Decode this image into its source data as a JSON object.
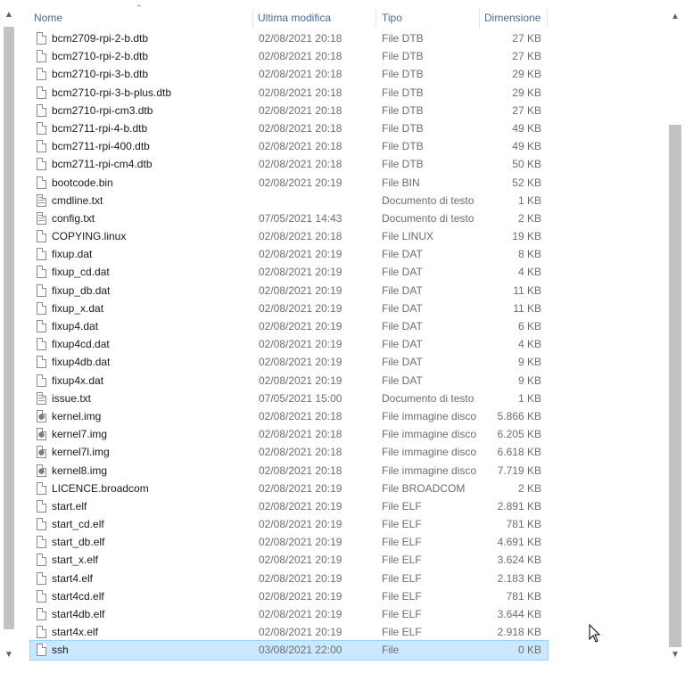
{
  "columns": {
    "name": "Nome",
    "modified": "Ultima modifica",
    "type": "Tipo",
    "size": "Dimensione"
  },
  "files": [
    {
      "name": "bcm2709-rpi-2-b.dtb",
      "modified": "02/08/2021 20:18",
      "type": "File DTB",
      "size": "27 KB",
      "icon": "file-icon"
    },
    {
      "name": "bcm2710-rpi-2-b.dtb",
      "modified": "02/08/2021 20:18",
      "type": "File DTB",
      "size": "27 KB",
      "icon": "file-icon"
    },
    {
      "name": "bcm2710-rpi-3-b.dtb",
      "modified": "02/08/2021 20:18",
      "type": "File DTB",
      "size": "29 KB",
      "icon": "file-icon"
    },
    {
      "name": "bcm2710-rpi-3-b-plus.dtb",
      "modified": "02/08/2021 20:18",
      "type": "File DTB",
      "size": "29 KB",
      "icon": "file-icon"
    },
    {
      "name": "bcm2710-rpi-cm3.dtb",
      "modified": "02/08/2021 20:18",
      "type": "File DTB",
      "size": "27 KB",
      "icon": "file-icon"
    },
    {
      "name": "bcm2711-rpi-4-b.dtb",
      "modified": "02/08/2021 20:18",
      "type": "File DTB",
      "size": "49 KB",
      "icon": "file-icon"
    },
    {
      "name": "bcm2711-rpi-400.dtb",
      "modified": "02/08/2021 20:18",
      "type": "File DTB",
      "size": "49 KB",
      "icon": "file-icon"
    },
    {
      "name": "bcm2711-rpi-cm4.dtb",
      "modified": "02/08/2021 20:18",
      "type": "File DTB",
      "size": "50 KB",
      "icon": "file-icon"
    },
    {
      "name": "bootcode.bin",
      "modified": "02/08/2021 20:19",
      "type": "File BIN",
      "size": "52 KB",
      "icon": "file-icon"
    },
    {
      "name": "cmdline.txt",
      "modified": "",
      "type": "Documento di testo",
      "size": "1 KB",
      "icon": "text-file-icon"
    },
    {
      "name": "config.txt",
      "modified": "07/05/2021 14:43",
      "type": "Documento di testo",
      "size": "2 KB",
      "icon": "text-file-icon"
    },
    {
      "name": "COPYING.linux",
      "modified": "02/08/2021 20:18",
      "type": "File LINUX",
      "size": "19 KB",
      "icon": "file-icon"
    },
    {
      "name": "fixup.dat",
      "modified": "02/08/2021 20:19",
      "type": "File DAT",
      "size": "8 KB",
      "icon": "file-icon"
    },
    {
      "name": "fixup_cd.dat",
      "modified": "02/08/2021 20:19",
      "type": "File DAT",
      "size": "4 KB",
      "icon": "file-icon"
    },
    {
      "name": "fixup_db.dat",
      "modified": "02/08/2021 20:19",
      "type": "File DAT",
      "size": "11 KB",
      "icon": "file-icon"
    },
    {
      "name": "fixup_x.dat",
      "modified": "02/08/2021 20:19",
      "type": "File DAT",
      "size": "11 KB",
      "icon": "file-icon"
    },
    {
      "name": "fixup4.dat",
      "modified": "02/08/2021 20:19",
      "type": "File DAT",
      "size": "6 KB",
      "icon": "file-icon"
    },
    {
      "name": "fixup4cd.dat",
      "modified": "02/08/2021 20:19",
      "type": "File DAT",
      "size": "4 KB",
      "icon": "file-icon"
    },
    {
      "name": "fixup4db.dat",
      "modified": "02/08/2021 20:19",
      "type": "File DAT",
      "size": "9 KB",
      "icon": "file-icon"
    },
    {
      "name": "fixup4x.dat",
      "modified": "02/08/2021 20:19",
      "type": "File DAT",
      "size": "9 KB",
      "icon": "file-icon"
    },
    {
      "name": "issue.txt",
      "modified": "07/05/2021 15:00",
      "type": "Documento di testo",
      "size": "1 KB",
      "icon": "text-file-icon"
    },
    {
      "name": "kernel.img",
      "modified": "02/08/2021 20:18",
      "type": "File immagine disco",
      "size": "5.866 KB",
      "icon": "disk-image-icon"
    },
    {
      "name": "kernel7.img",
      "modified": "02/08/2021 20:18",
      "type": "File immagine disco",
      "size": "6.205 KB",
      "icon": "disk-image-icon"
    },
    {
      "name": "kernel7l.img",
      "modified": "02/08/2021 20:18",
      "type": "File immagine disco",
      "size": "6.618 KB",
      "icon": "disk-image-icon"
    },
    {
      "name": "kernel8.img",
      "modified": "02/08/2021 20:18",
      "type": "File immagine disco",
      "size": "7.719 KB",
      "icon": "disk-image-icon"
    },
    {
      "name": "LICENCE.broadcom",
      "modified": "02/08/2021 20:19",
      "type": "File BROADCOM",
      "size": "2 KB",
      "icon": "file-icon"
    },
    {
      "name": "start.elf",
      "modified": "02/08/2021 20:19",
      "type": "File ELF",
      "size": "2.891 KB",
      "icon": "file-icon"
    },
    {
      "name": "start_cd.elf",
      "modified": "02/08/2021 20:19",
      "type": "File ELF",
      "size": "781 KB",
      "icon": "file-icon"
    },
    {
      "name": "start_db.elf",
      "modified": "02/08/2021 20:19",
      "type": "File ELF",
      "size": "4.691 KB",
      "icon": "file-icon"
    },
    {
      "name": "start_x.elf",
      "modified": "02/08/2021 20:19",
      "type": "File ELF",
      "size": "3.624 KB",
      "icon": "file-icon"
    },
    {
      "name": "start4.elf",
      "modified": "02/08/2021 20:19",
      "type": "File ELF",
      "size": "2.183 KB",
      "icon": "file-icon"
    },
    {
      "name": "start4cd.elf",
      "modified": "02/08/2021 20:19",
      "type": "File ELF",
      "size": "781 KB",
      "icon": "file-icon"
    },
    {
      "name": "start4db.elf",
      "modified": "02/08/2021 20:19",
      "type": "File ELF",
      "size": "3.644 KB",
      "icon": "file-icon"
    },
    {
      "name": "start4x.elf",
      "modified": "02/08/2021 20:19",
      "type": "File ELF",
      "size": "2.918 KB",
      "icon": "file-icon"
    },
    {
      "name": "ssh",
      "modified": "03/08/2021 22:00",
      "type": "File",
      "size": "0 KB",
      "icon": "file-icon",
      "selected": true
    }
  ],
  "colors": {
    "header_text": "#4c6a93",
    "selection_bg": "#cce8ff",
    "selection_border": "#99d1ff",
    "scroll_thumb": "#c2c2c2"
  }
}
